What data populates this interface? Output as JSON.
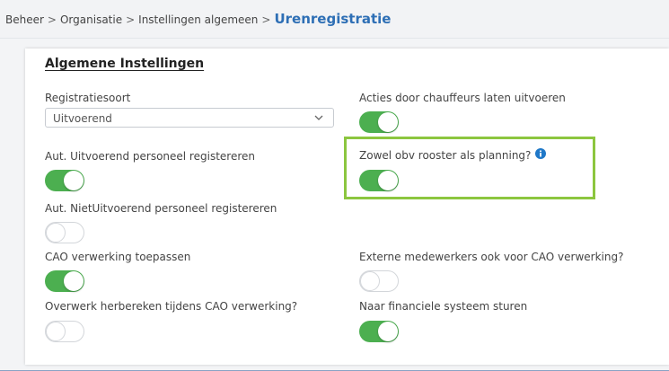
{
  "breadcrumb": {
    "items": [
      "Beheer",
      "Organisatie",
      "Instellingen algemeen"
    ],
    "separator": ">",
    "current": "Urenregistratie"
  },
  "section": {
    "title": "Algemene Instellingen"
  },
  "fields": {
    "registratiesoort": {
      "label": "Registratiesoort",
      "value": "Uitvoerend"
    },
    "acties_chauffeurs": {
      "label": "Acties door chauffeurs laten uitvoeren",
      "on": true
    },
    "aut_uitvoerend": {
      "label": "Aut. Uitvoerend personeel registereren",
      "on": true
    },
    "rooster_planning": {
      "label": "Zowel obv rooster als planning?",
      "on": true,
      "info_icon": "info-icon"
    },
    "aut_nietuitvoerend": {
      "label": "Aut. NietUitvoerend personeel registereren",
      "on": false
    },
    "cao_verwerking": {
      "label": "CAO verwerking toepassen",
      "on": true
    },
    "externe_medewerkers": {
      "label": "Externe medewerkers ook voor CAO verwerking?",
      "on": false
    },
    "overwerk": {
      "label": "Overwerk herbereken tijdens CAO verwerking?",
      "on": false
    },
    "financieel": {
      "label": "Naar financiele systeem sturen",
      "on": true
    }
  },
  "colors": {
    "toggle_on": "#4caf50",
    "highlight": "#8cc63f",
    "title_blue": "#2e6fb5",
    "info_blue": "#1f78c8"
  }
}
